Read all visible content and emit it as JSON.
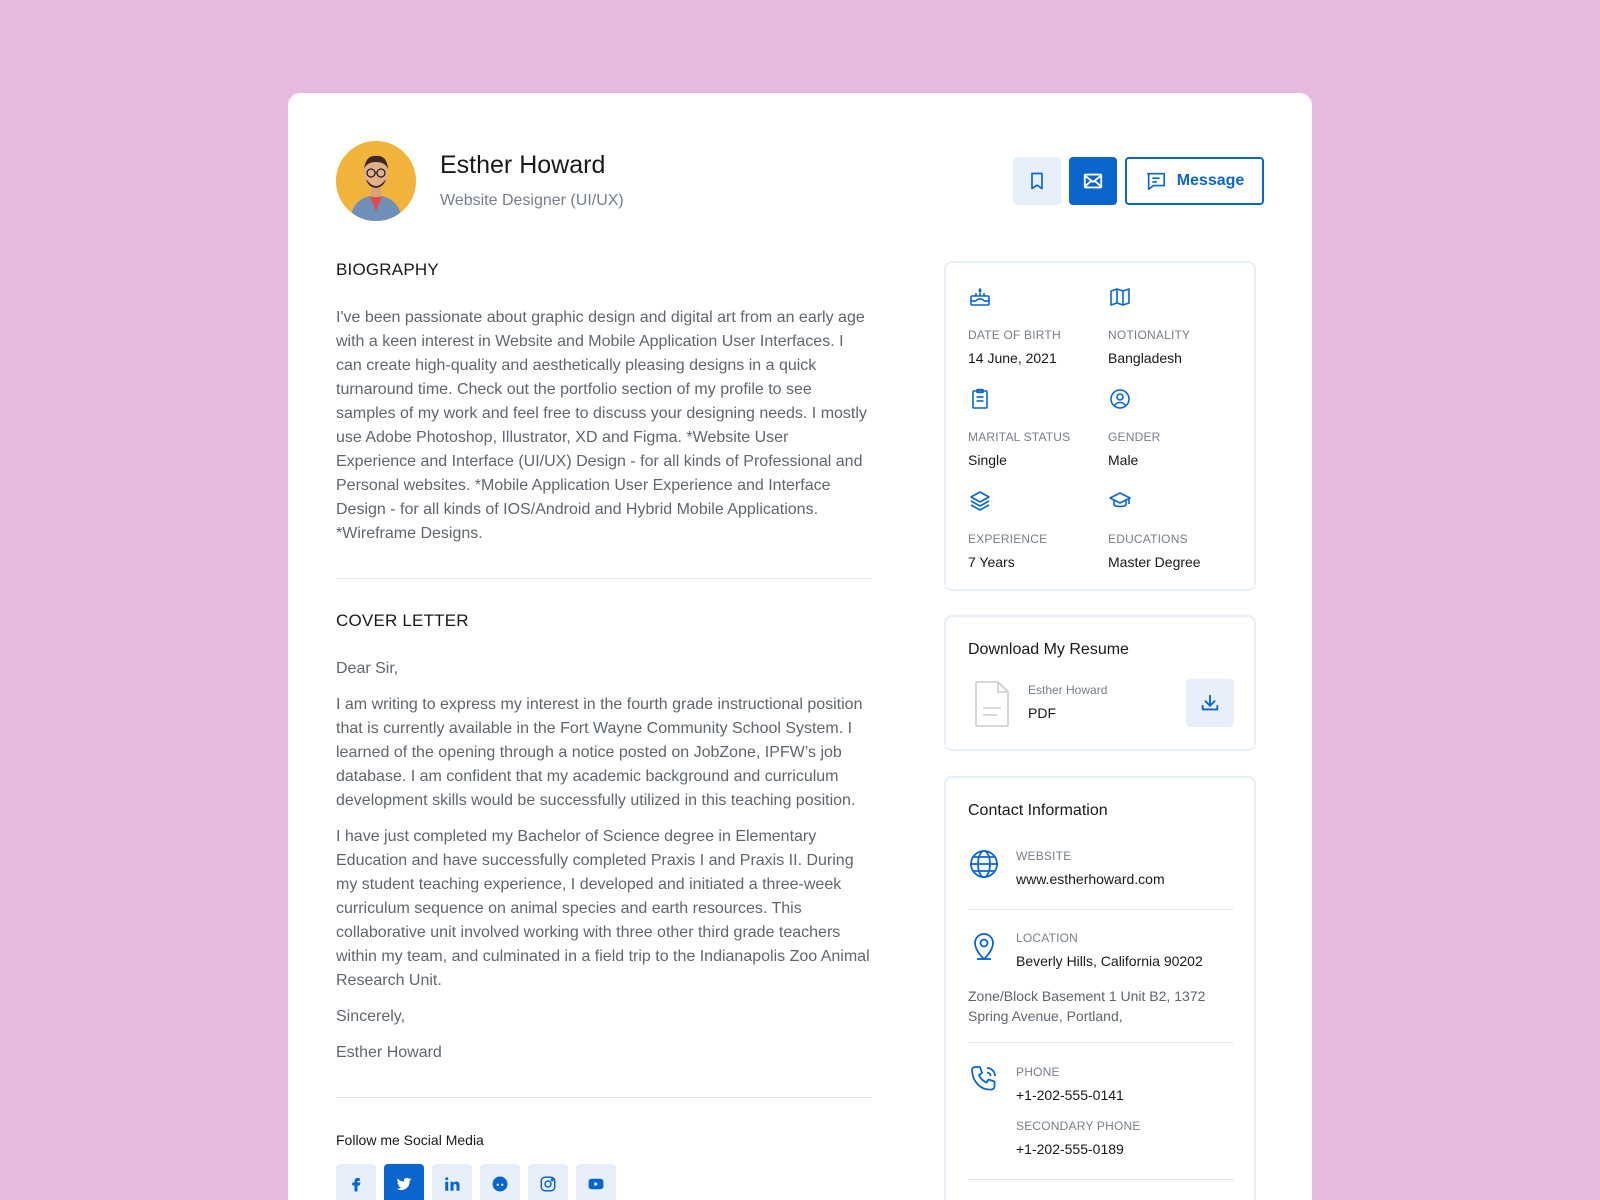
{
  "profile": {
    "name": "Esther Howard",
    "role": "Website Designer (UI/UX)"
  },
  "actions": {
    "message_label": "Message"
  },
  "biography": {
    "title": "BIOGRAPHY",
    "text": "I've been passionate about graphic design and digital art from an early age with a keen interest in Website and Mobile Application User Interfaces. I can create high-quality and aesthetically pleasing designs in a quick turnaround time. Check out the portfolio section of my profile to see samples of my work and feel free to discuss your designing needs. I mostly use Adobe Photoshop, Illustrator, XD and Figma. *Website User Experience and Interface (UI/UX) Design - for all kinds of Professional and Personal websites. *Mobile Application User Experience and Interface Design - for all kinds of IOS/Android and Hybrid Mobile Applications. *Wireframe Designs."
  },
  "cover_letter": {
    "title": "COVER LETTER",
    "greeting": "Dear Sir,",
    "paragraph1": "I am writing to express my interest in the fourth grade instructional position that is currently available in the Fort Wayne Community School System. I learned of the opening through a notice posted on JobZone, IPFW’s job database. I am confident that my academic background and curriculum development skills would be successfully utilized in this teaching position.",
    "paragraph2": "I have just completed my Bachelor of Science degree in Elementary Education and have successfully completed Praxis I and Praxis II. During my student teaching experience, I developed and initiated a three-week curriculum sequence on animal species and earth resources. This collaborative unit involved working with three other third grade teachers within my team, and culminated in a field trip to the Indianapolis Zoo Animal Research Unit.",
    "closing": "Sincerely,",
    "signature": "Esther Howard"
  },
  "social": {
    "title": "Follow me Social Media",
    "items": [
      {
        "name": "facebook",
        "glyph": "f",
        "active": false
      },
      {
        "name": "twitter",
        "glyph": "t",
        "active": true
      },
      {
        "name": "linkedin",
        "glyph": "in",
        "active": false
      },
      {
        "name": "reddit",
        "glyph": "r",
        "active": false
      },
      {
        "name": "instagram",
        "glyph": "ig",
        "active": false
      },
      {
        "name": "youtube",
        "glyph": "▶",
        "active": false
      }
    ]
  },
  "overview": {
    "dob_label": "DATE OF BIRTH",
    "dob_value": "14 June, 2021",
    "nationality_label": "NOTIONALITY",
    "nationality_value": "Bangladesh",
    "marital_label": "MARITAL STATUS",
    "marital_value": "Single",
    "gender_label": "GENDER",
    "gender_value": "Male",
    "experience_label": "EXPERIENCE",
    "experience_value": "7 Years",
    "education_label": "EDUCATIONS",
    "education_value": "Master Degree"
  },
  "resume": {
    "title": "Download My Resume",
    "file_owner": "Esther Howard",
    "file_type": "PDF"
  },
  "contact": {
    "title": "Contact Information",
    "website_label": "WEBSITE",
    "website_value": "www.estherhoward.com",
    "location_label": "LOCATION",
    "location_value": "Beverly Hills, California 90202",
    "address": "Zone/Block Basement 1 Unit B2, 1372 Spring Avenue, Portland,",
    "phone_label": "PHONE",
    "phone_value": "+1-202-555-0141",
    "secondary_phone_label": "SECONDARY PHONE",
    "secondary_phone_value": "+1-202-555-0189"
  },
  "colors": {
    "page_bg": "#e7b9de",
    "accent": "#0a65cc",
    "accent_light": "#e7f0fa"
  }
}
